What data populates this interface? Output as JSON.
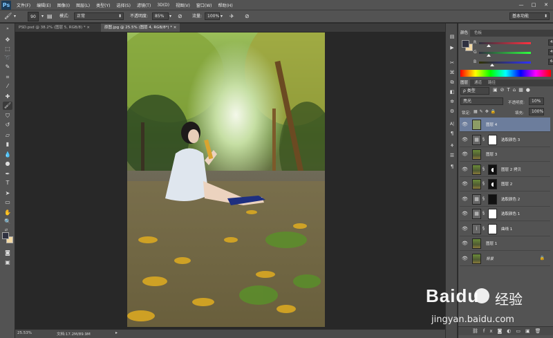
{
  "app": {
    "logo": "Ps"
  },
  "menubar": {
    "items": [
      "文件(F)",
      "编辑(E)",
      "图像(I)",
      "图层(L)",
      "类型(Y)",
      "选择(S)",
      "滤镜(T)",
      "3D(D)",
      "视图(V)",
      "窗口(W)",
      "帮助(H)"
    ],
    "window_buttons": [
      "—",
      "□",
      "✕"
    ]
  },
  "options": {
    "brush_size": "90",
    "mode_label": "模式:",
    "mode_value": "正常",
    "opacity_label": "不透明度:",
    "opacity_value": "85%",
    "flow_label": "流量:",
    "flow_value": "100%",
    "workspace": "基本功能"
  },
  "tabs": [
    {
      "label": "PSD.psd @ 38.2% (图层 5, RGB/8) *",
      "close": "×"
    },
    {
      "label": "原图.jpg @ 25.5% (图层 4, RGB/8*) *",
      "close": "×"
    }
  ],
  "status": {
    "zoom": "25.53%",
    "doc": "文档:17.2M/89.9M"
  },
  "color_panel": {
    "tabs": [
      "颜色",
      "色板"
    ],
    "channels": [
      {
        "label": "R",
        "value": "47",
        "fraction": 0.18
      },
      {
        "label": "G",
        "value": "49",
        "fraction": 0.19
      },
      {
        "label": "B",
        "value": "64",
        "fraction": 0.25
      }
    ],
    "fg_color": "#2f3140",
    "bg_color": "#f3d9a4"
  },
  "layers_panel": {
    "tabs": [
      "图层",
      "通道",
      "路径"
    ],
    "kind_label": "类型",
    "blend_mode": "亮光",
    "opacity_label": "不透明度:",
    "opacity_value": "10%",
    "lock_label": "锁定:",
    "fill_label": "填充:",
    "fill_value": "100%",
    "layers": [
      {
        "name": "图层 4",
        "thumb": "olive",
        "mask": false,
        "selected": true
      },
      {
        "name": "选取颜色 3",
        "thumb": "adj",
        "mask": "white",
        "selected": false
      },
      {
        "name": "图层 3",
        "thumb": "photo",
        "mask": false,
        "selected": false
      },
      {
        "name": "图层 2 拷贝",
        "thumb": "photo",
        "mask": "moon",
        "selected": false
      },
      {
        "name": "图层 2",
        "thumb": "photo",
        "mask": "moon",
        "selected": false
      },
      {
        "name": "选取颜色 2",
        "thumb": "adj",
        "mask": "dark",
        "selected": false
      },
      {
        "name": "选取颜色 1",
        "thumb": "adj",
        "mask": "white",
        "selected": false
      },
      {
        "name": "曲线 1",
        "thumb": "curve",
        "mask": "white",
        "selected": false
      },
      {
        "name": "图层 1",
        "thumb": "photo",
        "mask": false,
        "selected": false
      },
      {
        "name": "背景",
        "thumb": "photo",
        "mask": false,
        "selected": false,
        "locked": true
      }
    ]
  },
  "watermark": {
    "brand": "Baidu",
    "cn": "经验",
    "url": "jingyan.baidu.com"
  }
}
